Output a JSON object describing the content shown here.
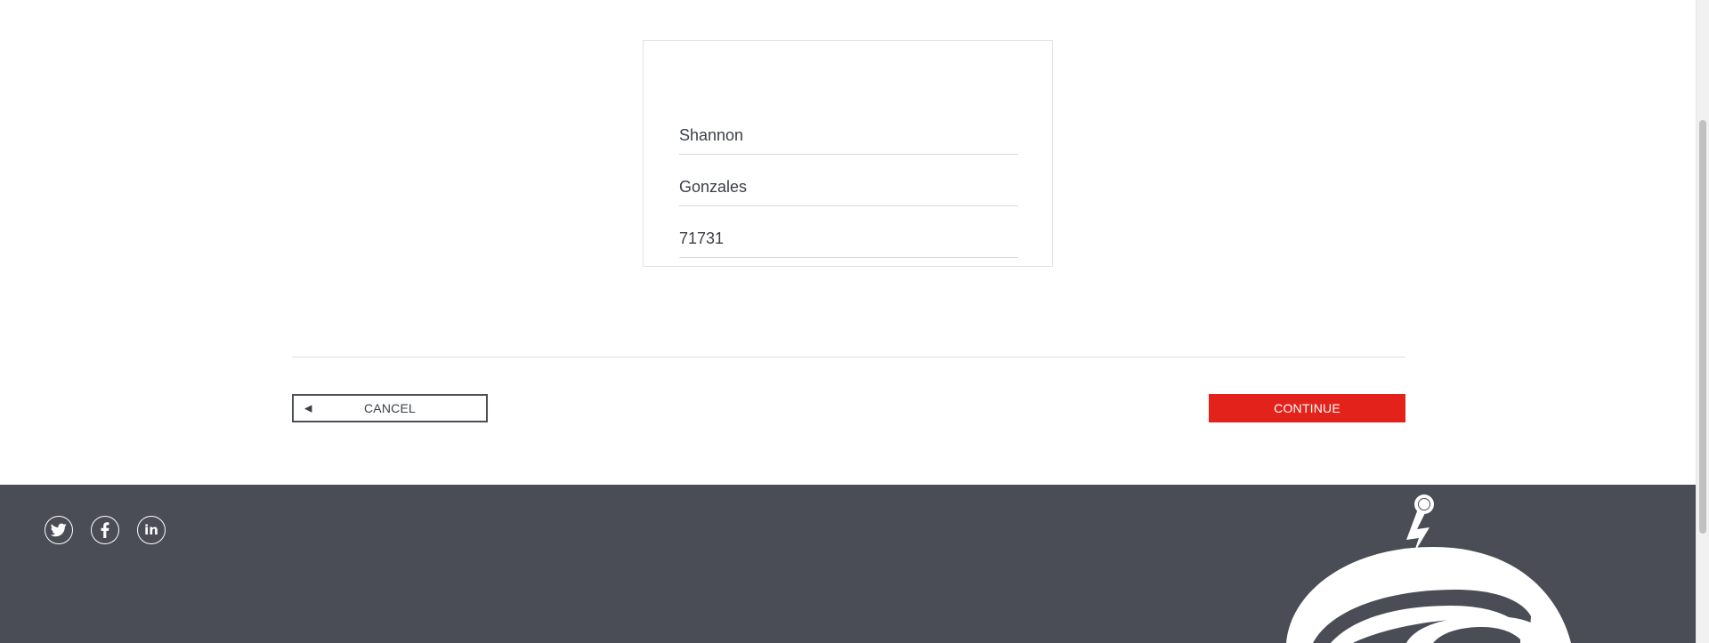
{
  "form": {
    "first_name": "Shannon",
    "last_name": "Gonzales",
    "zip": "71731"
  },
  "actions": {
    "cancel_label": "CANCEL",
    "cancel_icon": "◀",
    "continue_label": "CONTINUE"
  },
  "footer": {
    "social": [
      {
        "name": "twitter-icon"
      },
      {
        "name": "facebook-icon"
      },
      {
        "name": "linkedin-icon",
        "glyph": "in"
      }
    ]
  },
  "colors": {
    "accent": "#e3231b",
    "footer_bg": "#4a4d56",
    "text": "#3b3f46"
  }
}
